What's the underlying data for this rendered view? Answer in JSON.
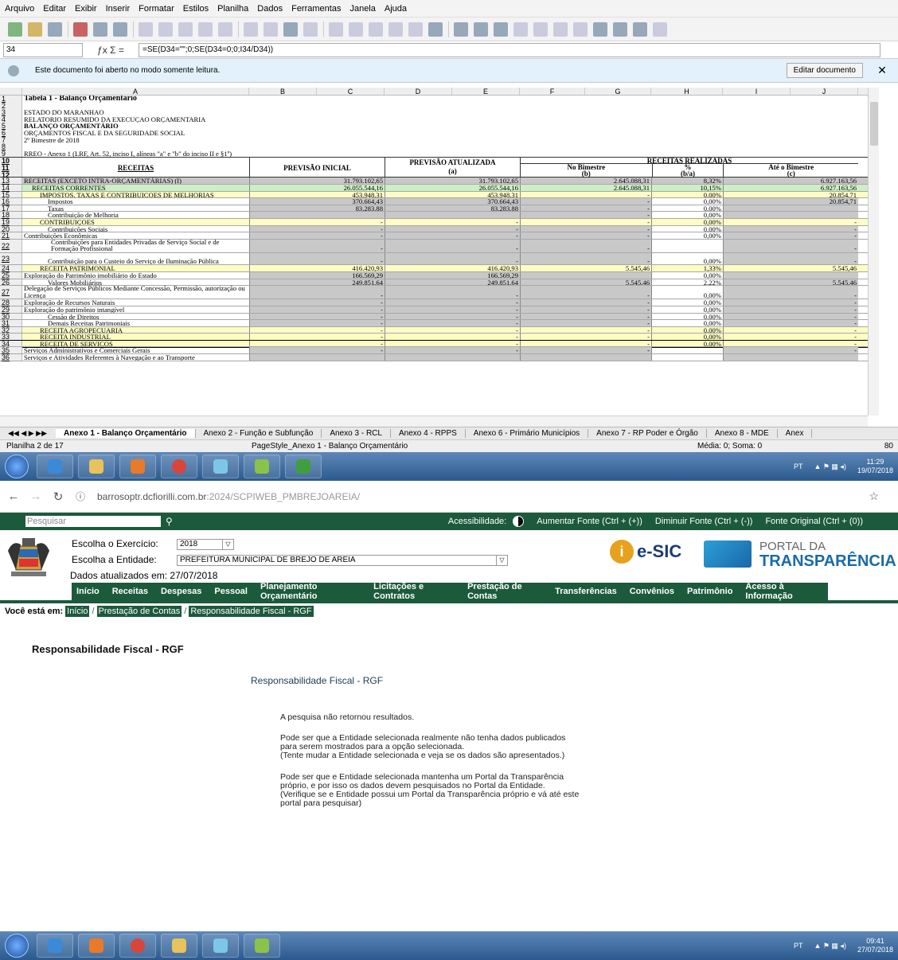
{
  "calc": {
    "menu": [
      "Arquivo",
      "Editar",
      "Exibir",
      "Inserir",
      "Formatar",
      "Estilos",
      "Planilha",
      "Dados",
      "Ferramentas",
      "Janela",
      "Ajuda"
    ],
    "name_box": "34",
    "formula": "=SE(D34=\"\";0;SE(D34=0;0;I34/D34))",
    "info_message": "Este documento foi aberto no modo somente leitura.",
    "edit_button": "Editar documento",
    "close_glyph": "✕",
    "col_headers": [
      "A",
      "B",
      "C",
      "D",
      "E",
      "F",
      "G",
      "H",
      "I",
      "J"
    ],
    "header_rows": [
      {
        "n": "1",
        "a": "Tabela 1 - Balanço Orçamentário",
        "bold": true
      },
      {
        "n": "2",
        "a": ""
      },
      {
        "n": "3",
        "a": "ESTADO DO MARANHAO"
      },
      {
        "n": "4",
        "a": "RELATORIO RESUMIDO DA EXECUÇAO ORÇAMENTARIA"
      },
      {
        "n": "5",
        "a": "BALANÇO ORÇAMENTÁRIO",
        "bold": true
      },
      {
        "n": "6",
        "a": "ORÇAMENTOS FISCAL E DA SEGURIDADE SOCIAL"
      },
      {
        "n": "7",
        "a": "2º Bimestre de 2018"
      },
      {
        "n": "8",
        "a": ""
      },
      {
        "n": "9",
        "a": "RREO - Anexo 1 (LRF, Art. 52, inciso I, alíneas \"a\" e \"b\" do inciso II e §1º)"
      }
    ],
    "table_head": {
      "receitas": "RECEITAS",
      "prev_inicial": "PREVISÃO INICIAL",
      "prev_atualizada": "PREVISÃO ATUALIZADA",
      "prev_atualizada_sub": "(a)",
      "realizadas": "RECEITAS REALIZADAS",
      "no_bimestre": "No Bimestre",
      "no_bimestre_sub": "(b)",
      "pct": "%",
      "pct_sub": "(b/a)",
      "ate_bimestre": "Até o Bimestre",
      "ate_bimestre_sub": "(c)",
      "row_numbers": [
        "10",
        "11",
        "12"
      ]
    },
    "rows": [
      {
        "n": "13",
        "label": "RECEITAS (EXCETO INTRA-ORÇAMENTÁRIAS) (I)",
        "ind": 0,
        "b": "31.793.102,65",
        "d": "31.793.102,65",
        "f": "2.645.088,31",
        "h": "8,32%",
        "i": "6.927.163,56",
        "bg": "#c8c8c8"
      },
      {
        "n": "14",
        "label": "RECEITAS CORRENTES",
        "ind": 10,
        "b": "26.055.544,16",
        "d": "26.055.544,16",
        "f": "2.645.088,31",
        "h": "10,15%",
        "i": "6.927.163,56",
        "bg": "#cdeec6"
      },
      {
        "n": "15",
        "label": "IMPOSTOS, TAXAS E CONTRIBUIÇOES DE MELHORIAS",
        "ind": 20,
        "b": "453.948,31",
        "d": "453.948,31",
        "f": "-",
        "h": "0,00%",
        "i": "20.854,71",
        "bg": "#fdfcc4"
      },
      {
        "n": "16",
        "label": "Impostos",
        "ind": 30,
        "b": "370.664,43",
        "d": "370.664,43",
        "f": "-",
        "h": "0,00%",
        "i": "20.854,71",
        "bg": "gray"
      },
      {
        "n": "17",
        "label": "Taxas",
        "ind": 30,
        "b": "83.283,88",
        "d": "83.283,88",
        "f": "-",
        "h": "0,00%",
        "i": "",
        "bg": "gray"
      },
      {
        "n": "18",
        "label": "Contribuição de Melhoria",
        "ind": 30,
        "b": "",
        "d": "",
        "f": "-",
        "h": "0,00%",
        "i": "",
        "bg": "gray"
      },
      {
        "n": "19",
        "label": "CONTRIBUIÇOES",
        "ind": 20,
        "b": "-",
        "d": "-",
        "f": "-",
        "h": "0,00%",
        "i": "-",
        "bg": "#fdfcc4"
      },
      {
        "n": "20",
        "label": "Contribuições Sociais",
        "ind": 30,
        "b": "-",
        "d": "-",
        "f": "-",
        "h": "0,00%",
        "i": "-",
        "bg": "gray"
      },
      {
        "n": "21",
        "label": "Contribuições Econômicas",
        "ind": 0,
        "b": "-",
        "d": "-",
        "f": "-",
        "h": "0,00%",
        "i": "-",
        "bg": "gray"
      },
      {
        "n": "22",
        "label": "Contribuições para Entidades Privadas de Serviço Social e de Formação Profissional",
        "ind": 34,
        "b": "-",
        "d": "-",
        "f": "-",
        "h": "",
        "i": "-",
        "bg": "gray",
        "tall": 2
      },
      {
        "n": "23",
        "label": "Contribuição para o Custeio do Serviço de Iluminação Pública",
        "ind": 30,
        "b": "-",
        "d": "-",
        "f": "-",
        "h": "0,00%",
        "i": "-",
        "bg": "gray",
        "tall": 1.8
      },
      {
        "n": "24",
        "label": "RECEITA PATRIMONIAL",
        "ind": 20,
        "b": "416.420,93",
        "d": "416.420,93",
        "f": "5.545,46",
        "h": "1,33%",
        "i": "5.545,46",
        "bg": "#fdfcc4"
      },
      {
        "n": "25",
        "label": "Exploração do Patrimônio imobiliário do Estado",
        "ind": 0,
        "b": "166.569,29",
        "d": "166.569,29",
        "f": "",
        "h": "0,00%",
        "i": "",
        "bg": "gray"
      },
      {
        "n": "26",
        "label": "Valores Mobiliários",
        "ind": 30,
        "b": "249.851,64",
        "d": "249.851,64",
        "f": "5.545,46",
        "h": "2,22%",
        "i": "5.545,46",
        "bg": "gray"
      },
      {
        "n": "27",
        "label": "Delegação de Serviços Públicos Mediante Concessão, Permissão, autorização ou Licença",
        "ind": 0,
        "b": "-",
        "d": "-",
        "f": "-",
        "h": "0,00%",
        "i": "-",
        "bg": "gray",
        "tall": 2
      },
      {
        "n": "28",
        "label": "Exploração de Recursos Naturais",
        "ind": 0,
        "b": "-",
        "d": "-",
        "f": "-",
        "h": "0,00%",
        "i": "-",
        "bg": "gray"
      },
      {
        "n": "29",
        "label": "Exploração do patrimônio intangível",
        "ind": 0,
        "b": "-",
        "d": "-",
        "f": "-",
        "h": "0,00%",
        "i": "-",
        "bg": "gray"
      },
      {
        "n": "30",
        "label": "Cessão de Direitos",
        "ind": 30,
        "b": "-",
        "d": "-",
        "f": "-",
        "h": "0,00%",
        "i": "-",
        "bg": "gray"
      },
      {
        "n": "31",
        "label": "Demais Receitas Patrimoniais",
        "ind": 30,
        "b": "-",
        "d": "-",
        "f": "-",
        "h": "0,00%",
        "i": "-",
        "bg": "gray"
      },
      {
        "n": "32",
        "label": "RECEITA AGROPECUARIA",
        "ind": 20,
        "b": "-",
        "d": "-",
        "f": "-",
        "h": "0,00%",
        "i": "-",
        "bg": "#fdfcc4"
      },
      {
        "n": "33",
        "label": "RECEITA INDUSTRIAL",
        "ind": 20,
        "b": "-",
        "d": "-",
        "f": "-",
        "h": "0,00%",
        "i": "-",
        "bg": "#fdfcc4"
      },
      {
        "n": "34",
        "label": "RECEITA DE SERVIÇOS",
        "ind": 20,
        "b": "-",
        "d": "-",
        "f": "-",
        "h": "0,00%",
        "i": "-",
        "bg": "#fdfcc4"
      },
      {
        "n": "35",
        "label": "Serviços Administrativos e Comerciais Gerais",
        "ind": 0,
        "b": "-",
        "d": "-",
        "f": "-",
        "h": "",
        "i": "-",
        "bg": "gray"
      },
      {
        "n": "36",
        "label": "Serviços e Atividades Referentes à Navegação e ao Transporte",
        "ind": 0,
        "b": "",
        "d": "",
        "f": "",
        "h": "",
        "i": "",
        "bg": "gray"
      }
    ],
    "sheet_tabs": [
      "Anexo 1 - Balanço Orçamentário",
      "Anexo 2 - Função e Subfunção",
      "Anexo 3 - RCL",
      "Anexo 4 - RPPS",
      "Anexo 6 - Primário Municípios",
      "Anexo 7 - RP Poder e Órgão",
      "Anexo 8 - MDE",
      "Anex"
    ],
    "status_sheet": "Planilha 2 de 17",
    "status_style": "PageStyle_Anexo 1 - Balanço Orçamentário",
    "status_sum": "Média: 0; Soma: 0",
    "status_zoom": "80"
  },
  "taskbar_top": {
    "lang": "PT",
    "time": "11:29",
    "date": "19/07/2018"
  },
  "taskbar_bottom": {
    "lang": "PT",
    "time": "09:41",
    "date": "27/07/2018"
  },
  "browser": {
    "url_host": "barrosoptr.dcfiorilli.com.br",
    "url_path": ":2024/SCPIWEB_PMBREJOAREIA/",
    "search_placeholder": "Pesquisar",
    "accessibility": "Acessibilidade:",
    "font_up": "Aumentar Fonte (Ctrl + (+))",
    "font_down": "Diminuir Fonte (Ctrl + (-))",
    "font_orig": "Fonte Original (Ctrl + (0))",
    "exercicio_label": "Escolha o Exercício:",
    "exercicio_value": "2018",
    "entidade_label": "Escolha a Entidade:",
    "entidade_value": "PREFEITURA MUNICIPAL DE BREJO DE AREIA",
    "updated": "Dados atualizados em: 27/07/2018",
    "esic": "e-SIC",
    "portal_a": "PORTAL DA",
    "portal_b": "TRANSPARÊNCIA",
    "nav": [
      "Início",
      "Receitas",
      "Despesas",
      "Pessoal",
      "Planejamento Orçamentário",
      "Licitações e Contratos",
      "Prestação de Contas",
      "Transferências",
      "Convênios",
      "Patrimônio",
      "Acesso à Informação"
    ],
    "crumb_label": "Você está em:",
    "crumbs": [
      "Início",
      "Prestação de Contas",
      "Responsabilidade Fiscal - RGF"
    ],
    "title": "Responsabilidade Fiscal - RGF",
    "subtitle": "Responsabilidade Fiscal - RGF",
    "p1": "A pesquisa não retornou resultados.",
    "p2": [
      "Pode ser que a Entidade selecionada realmente não tenha dados publicados",
      "para serem mostrados para a opção selecionada.",
      "(Tente mudar a Entidade selecionada e veja se os dados são apresentados.)"
    ],
    "p3": [
      "Pode ser que e Entidade selecionada mantenha um Portal da Transparência",
      "próprio, e por isso os dados devem pesquisados no Portal da Entidade.",
      "(Verifique se e Entidade possui um Portal da Transparência próprio e vá até este",
      "portal para pesquisar)"
    ]
  }
}
